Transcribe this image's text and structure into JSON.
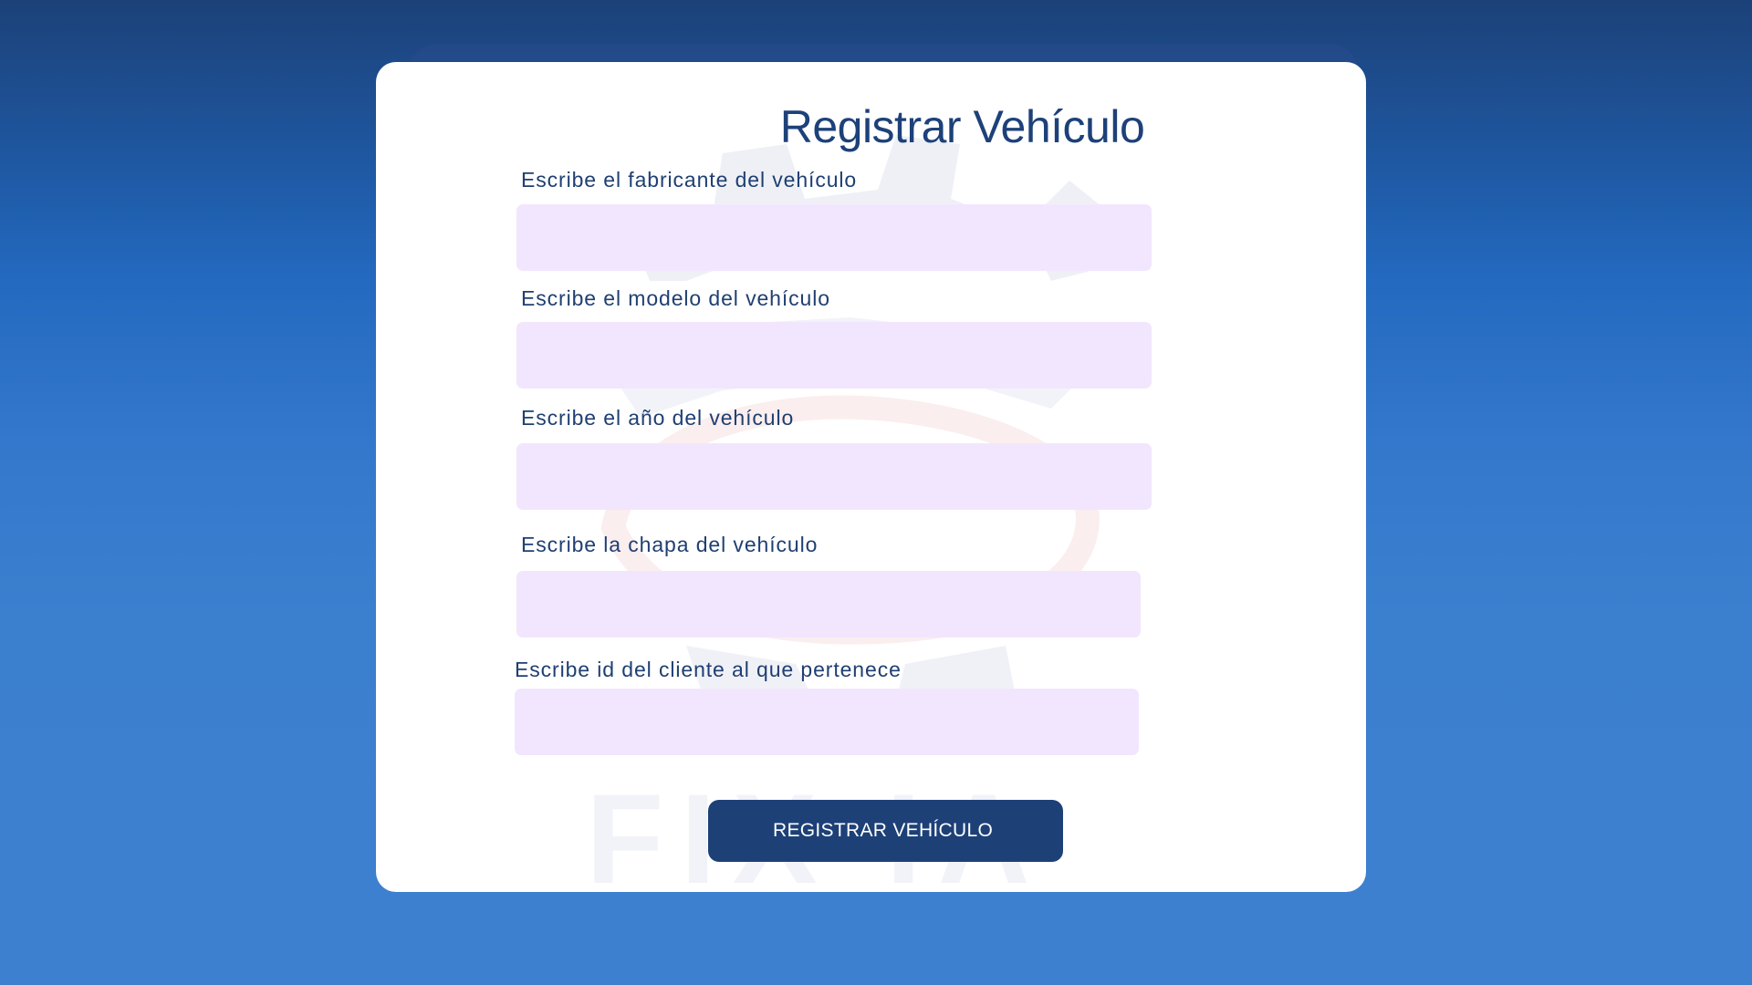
{
  "page": {
    "background_top": "#1c4178",
    "background_bottom": "#3d80cf",
    "card_color": "#ffffff"
  },
  "form": {
    "title": "Registrar Vehículo",
    "fields": [
      {
        "label": "Escribe el fabricante del vehículo",
        "value": "",
        "placeholder": ""
      },
      {
        "label": "Escribe el modelo del vehículo",
        "value": "",
        "placeholder": ""
      },
      {
        "label": "Escribe el año del vehículo",
        "value": "",
        "placeholder": ""
      },
      {
        "label": "Escribe la chapa del vehículo",
        "value": "",
        "placeholder": ""
      },
      {
        "label": "Escribe id del cliente al que pertenece",
        "value": "",
        "placeholder": ""
      }
    ],
    "submit_label": "REGISTRAR VEHÍCULO",
    "input_color": "#f2e6fe",
    "accent_color": "#1d4077"
  },
  "watermark": {
    "text": "FIX IA",
    "icon": "gear-logo-icon"
  }
}
